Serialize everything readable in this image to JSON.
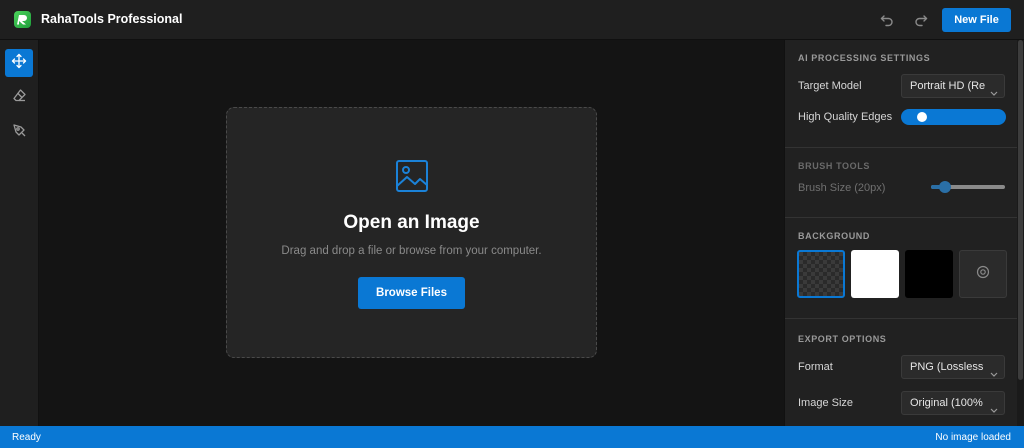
{
  "app": {
    "title": "RahaTools Professional"
  },
  "header": {
    "new_file_label": "New File"
  },
  "dropzone": {
    "title": "Open an Image",
    "subtitle": "Drag and drop a file or browse from your computer.",
    "browse_label": "Browse Files"
  },
  "panel": {
    "ai": {
      "title": "AI PROCESSING SETTINGS",
      "model_label": "Target Model",
      "model_value": "Portrait HD (Re",
      "edges_label": "High Quality Edges",
      "edges_on": true
    },
    "brush": {
      "title": "BRUSH TOOLS",
      "size_label": "Brush Size (20px)",
      "size_value": 20
    },
    "background": {
      "title": "BACKGROUND",
      "options": [
        "transparent",
        "white",
        "black",
        "custom"
      ],
      "selected": "transparent"
    },
    "export": {
      "title": "EXPORT OPTIONS",
      "format_label": "Format",
      "format_value": "PNG (Lossless",
      "size_label": "Image Size",
      "size_value": "Original (100%"
    }
  },
  "status": {
    "left": "Ready",
    "right": "No image loaded"
  },
  "colors": {
    "accent": "#0a78d4",
    "background": "#141414",
    "panel": "#212121"
  },
  "icons": {
    "logo": "app-logo-icon",
    "undo": "undo-icon",
    "redo": "redo-icon",
    "move": "move-icon",
    "eraser": "eraser-icon",
    "pen": "pen-icon",
    "image": "image-icon",
    "chevron": "chevron-down-icon",
    "custom_color": "color-picker-icon"
  }
}
